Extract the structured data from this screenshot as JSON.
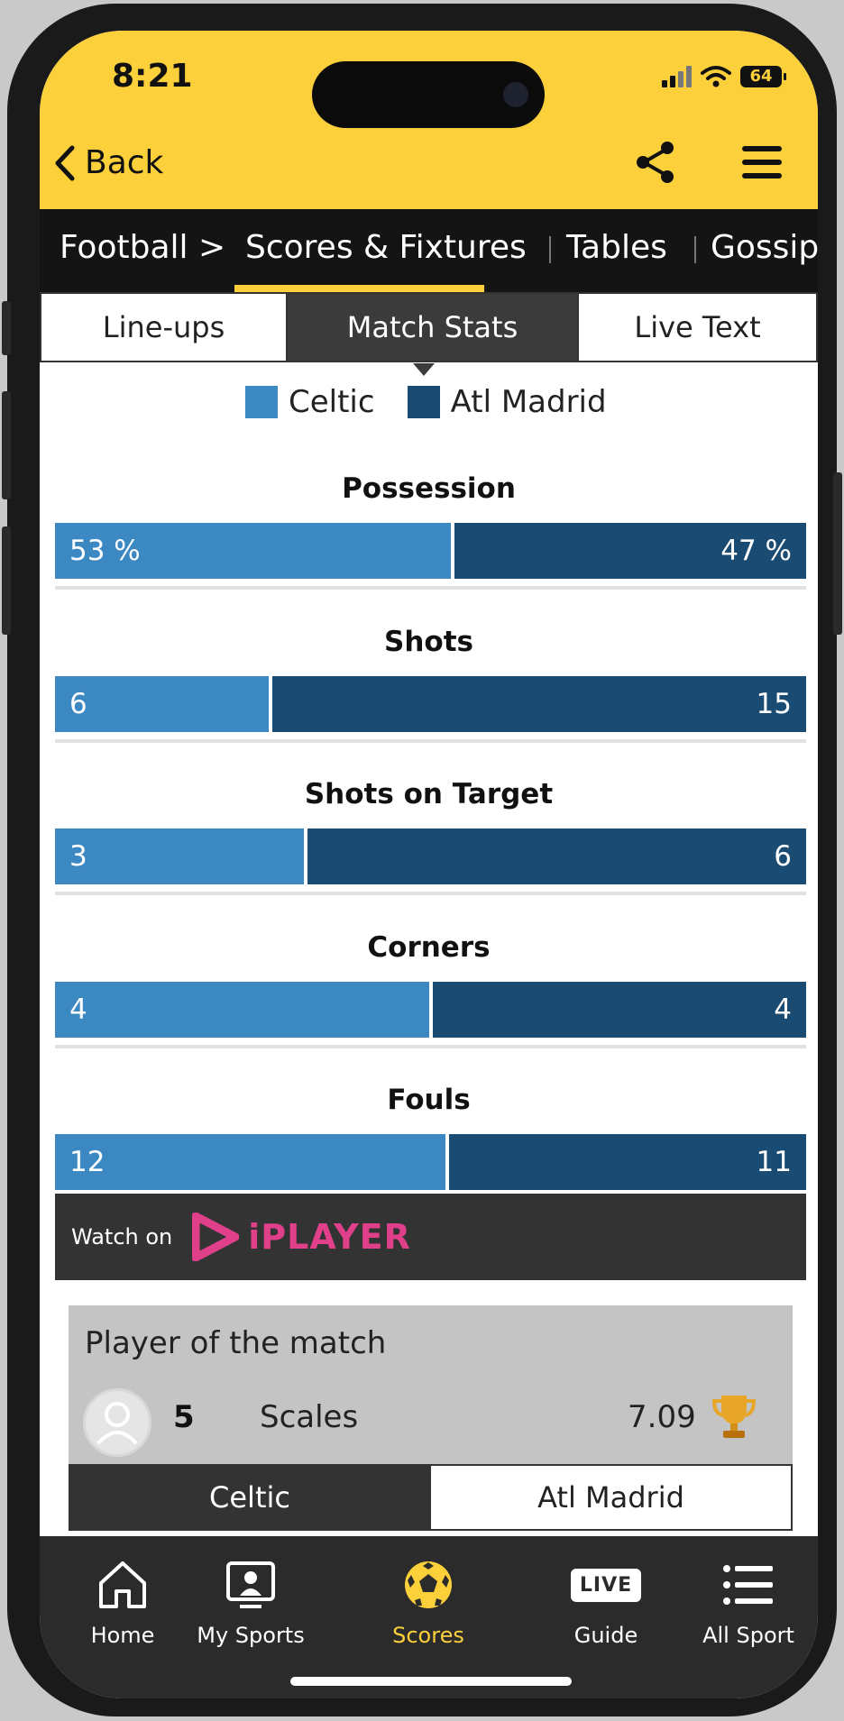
{
  "status_bar": {
    "time": "8:21",
    "battery": "64"
  },
  "header": {
    "back_label": "Back"
  },
  "nav": {
    "football": "Football >",
    "scores_fixtures": "Scores & Fixtures",
    "tables": "Tables",
    "gossip": "Gossip"
  },
  "tabs": {
    "lineups": "Line-ups",
    "match_stats": "Match Stats",
    "live_text": "Live Text"
  },
  "legend": {
    "home": "Celtic",
    "away": "Atl Madrid",
    "home_color": "#3b88c3",
    "away_color": "#1a4b73"
  },
  "stats": [
    {
      "title": "Possession",
      "home": "53 %",
      "away": "47 %",
      "home_value": 53,
      "away_value": 47
    },
    {
      "title": "Shots",
      "home": "6",
      "away": "15",
      "home_value": 6,
      "away_value": 15
    },
    {
      "title": "Shots on Target",
      "home": "3",
      "away": "6",
      "home_value": 3,
      "away_value": 6
    },
    {
      "title": "Corners",
      "home": "4",
      "away": "4",
      "home_value": 4,
      "away_value": 4
    },
    {
      "title": "Fouls",
      "home": "12",
      "away": "11",
      "home_value": 12,
      "away_value": 11
    }
  ],
  "iplayer": {
    "watch_on": "Watch on",
    "brand": "iPLAYER"
  },
  "player_of_match": {
    "title": "Player of the match",
    "number": "5",
    "name": "Scales",
    "rating": "7.09"
  },
  "team_tabs": {
    "home": "Celtic",
    "away": "Atl Madrid"
  },
  "bottom_nav": {
    "home": "Home",
    "my_sports": "My Sports",
    "scores": "Scores",
    "guide": "Guide",
    "guide_badge": "LIVE",
    "all_sport": "All Sport"
  }
}
